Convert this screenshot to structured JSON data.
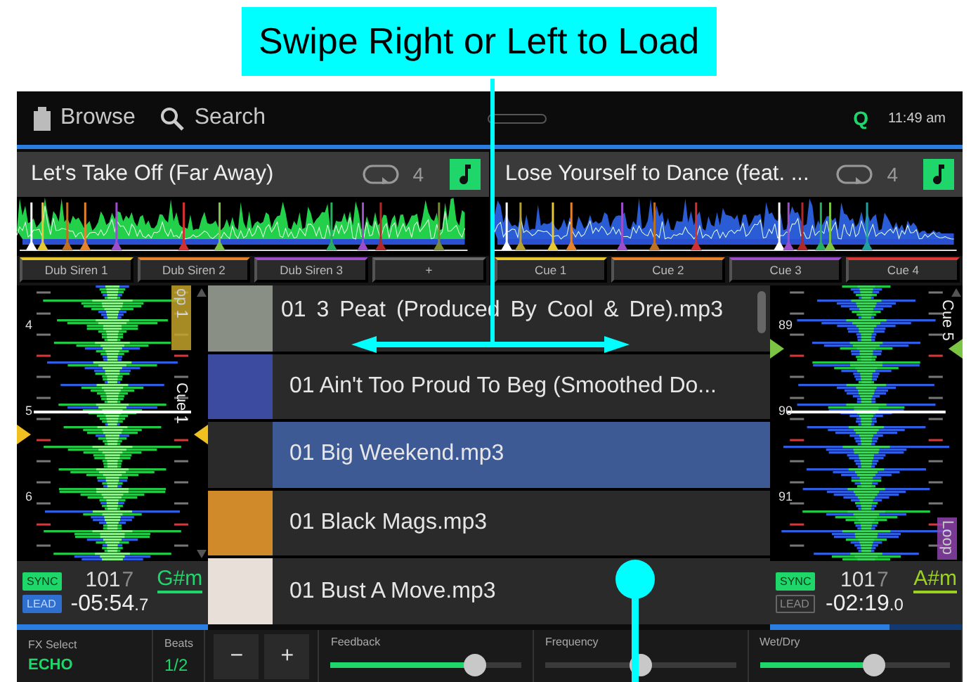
{
  "callout": {
    "text": "Swipe Right or Left to Load"
  },
  "top_bar": {
    "browse": "Browse",
    "search": "Search",
    "quantize": "Q",
    "time": "11:49 am"
  },
  "decks": [
    {
      "title": "Let's Take Off (Far Away)",
      "loop_size": "4",
      "pads": [
        {
          "label": "Dub Siren 1",
          "color": "#e8c830"
        },
        {
          "label": "Dub Siren 2",
          "color": "#e8822a"
        },
        {
          "label": "Dub Siren 3",
          "color": "#9b4dca"
        },
        {
          "label": "+",
          "color": "#6a6a6a"
        }
      ],
      "beats": [
        "4",
        "5",
        "6"
      ],
      "markers": [
        {
          "kind": "loop",
          "label": "op 1",
          "color": "#c4a42c"
        },
        {
          "kind": "cue",
          "label": "Cue 1",
          "color": "#f0c020"
        }
      ],
      "sync": {
        "label": "SYNC",
        "on": true
      },
      "lead": {
        "label": "LEAD",
        "on": true
      },
      "bpm": "101",
      "bpm_decimal": "7",
      "time": "-05:54",
      "time_tenths": ".7",
      "key": {
        "text": "G#m",
        "color": "#1fd66b"
      },
      "progress": {
        "level": 1
      }
    },
    {
      "title": "Lose Yourself to Dance (feat. ...",
      "loop_size": "4",
      "pads": [
        {
          "label": "Cue 1",
          "color": "#e8c830"
        },
        {
          "label": "Cue 2",
          "color": "#e8822a"
        },
        {
          "label": "Cue 3",
          "color": "#9b4dca"
        },
        {
          "label": "Cue 4",
          "color": "#d83838"
        }
      ],
      "beats": [
        "89",
        "90",
        "91"
      ],
      "markers": [
        {
          "kind": "cue",
          "label": "Cue 5",
          "color": "#7cc444"
        },
        {
          "kind": "loop",
          "label": "Loop",
          "color": "#8e44ad"
        }
      ],
      "sync": {
        "label": "SYNC",
        "on": true
      },
      "lead": {
        "label": "LEAD",
        "on": false
      },
      "bpm": "101",
      "bpm_decimal": "7",
      "time": "-02:19",
      "time_tenths": ".0",
      "key": {
        "text": "A#m",
        "color": "#9ad21e"
      },
      "progress": {
        "level": 0.62
      }
    }
  ],
  "library": {
    "tracks": [
      {
        "title": "01 3 Peat (Produced By Cool & Dre).mp3",
        "selected": false
      },
      {
        "title": "01 Ain't Too Proud To Beg (Smoothed Do...",
        "selected": false
      },
      {
        "title": "01 Big Weekend.mp3",
        "selected": true
      },
      {
        "title": "01 Black Mags.mp3",
        "selected": false
      },
      {
        "title": "01 Bust A Move.mp3",
        "selected": false
      }
    ]
  },
  "fx_bar": {
    "fx_select_label": "FX Select",
    "fx_select_value": "ECHO",
    "beats_label": "Beats",
    "beats_value": "1/2",
    "minus": "−",
    "plus": "+",
    "sliders": [
      {
        "label": "Feedback",
        "kind": "unipolar",
        "level": 0.76
      },
      {
        "label": "Frequency",
        "kind": "bipolar",
        "level": 0.5
      },
      {
        "label": "Wet/Dry",
        "kind": "unipolar",
        "level": 0.6
      }
    ]
  }
}
